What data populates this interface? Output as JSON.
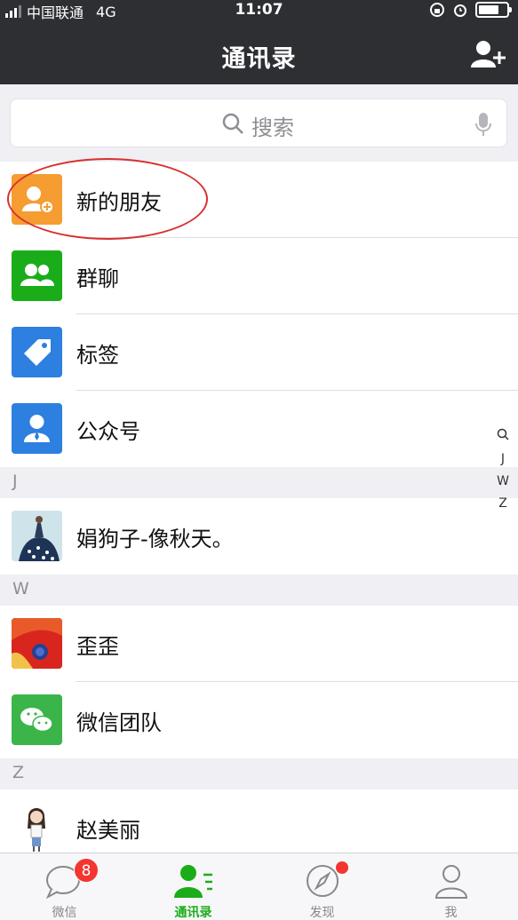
{
  "status_bar": {
    "carrier": "中国联通",
    "network": "4G",
    "time": "11:07"
  },
  "header": {
    "title": "通讯录",
    "add_icon": "add-contact-icon"
  },
  "search": {
    "placeholder": "搜索"
  },
  "menu": [
    {
      "label": "新的朋友",
      "icon": "new-friend-icon",
      "color": "#f59d30"
    },
    {
      "label": "群聊",
      "icon": "group-chat-icon",
      "color": "#1aad19"
    },
    {
      "label": "标签",
      "icon": "tag-icon",
      "color": "#2d7fe0"
    },
    {
      "label": "公众号",
      "icon": "official-account-icon",
      "color": "#2d7fe0"
    }
  ],
  "sections": [
    {
      "letter": "J",
      "contacts": [
        {
          "name": "娟狗子-像秋天。",
          "avatar": "girl-dress-avatar"
        }
      ]
    },
    {
      "letter": "W",
      "contacts": [
        {
          "name": "歪歪",
          "avatar": "red-paint-avatar"
        },
        {
          "name": "微信团队",
          "avatar": "wechat-logo-avatar"
        }
      ]
    },
    {
      "letter": "Z",
      "contacts": [
        {
          "name": "赵美丽",
          "avatar": "cartoon-girl-avatar"
        }
      ]
    }
  ],
  "index_bar": [
    "J",
    "W",
    "Z"
  ],
  "tabs": [
    {
      "label": "微信",
      "badge": "8",
      "icon": "chat-bubble-icon"
    },
    {
      "label": "通讯录",
      "icon": "contacts-icon",
      "active": true
    },
    {
      "label": "发现",
      "icon": "compass-icon",
      "dot": true
    },
    {
      "label": "我",
      "icon": "person-icon"
    }
  ],
  "colors": {
    "header_bg": "#2e2f33",
    "accent_green": "#1aad19",
    "badge_red": "#f43530"
  }
}
